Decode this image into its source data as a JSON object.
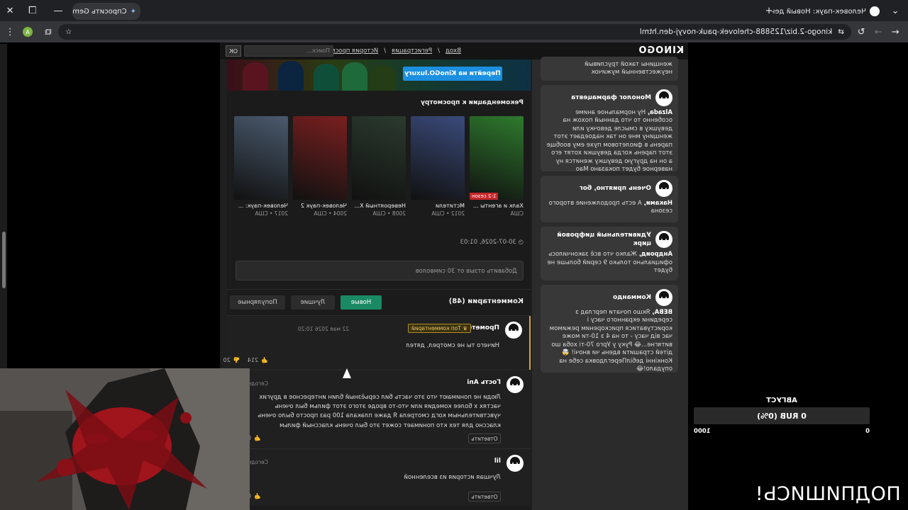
{
  "browser": {
    "tabs": [
      {
        "title": "Человек-паук: Новый день с"
      },
      {
        "title": "Спросить Gemini"
      }
    ],
    "new_tab": "+",
    "url": "kinogo-2.biz/125888-chelovek-pauk-novyj-den.html",
    "profile_initial": "A"
  },
  "site": {
    "logo": "KINOGO",
    "nav": [
      "Вход",
      "Регистрация",
      "История просмотров"
    ],
    "nav_separator": "/",
    "search_placeholder": "Поиск...",
    "search_button": "ОК",
    "banner_button": "Перейти на KinoGO.luxury"
  },
  "recommendations": {
    "title": "Рекомендации к просмотру",
    "items": [
      {
        "title": "Халк и агенты ...",
        "meta": "США",
        "badge": "1-2 сезон",
        "color": "#2e7a2d"
      },
      {
        "title": "Мстители",
        "meta": "2012 • США",
        "badge": "",
        "color": "#3a4a7a"
      },
      {
        "title": "Невероятный Х...",
        "meta": "2008 • США",
        "badge": "",
        "color": "#2b3a2e"
      },
      {
        "title": "Человек-паук 2",
        "meta": "2004 • США",
        "badge": "",
        "color": "#7a1f1f"
      },
      {
        "title": "Человек-паук: ...",
        "meta": "2017 • США",
        "badge": "",
        "color": "#4a5a6e"
      }
    ]
  },
  "publication_date": "30-07-2026, 01:03",
  "review": {
    "placeholder": "Добавить отзыв от 30 символов"
  },
  "comments": {
    "title": "Комментарии (48)",
    "filters": [
      "Новые",
      "Лучшие",
      "Популярные"
    ],
    "active_filter": "Новые",
    "items": [
      {
        "name": "Прометей",
        "badge": "Топ комментарий",
        "time": "22 мая 2026 10:20",
        "text": "Ничего ты не смотрел, дятел",
        "likes": "214",
        "dislikes": "20"
      },
      {
        "name": "Гость Ani",
        "time": "Сегодня",
        "text": "Люди не понимают что это часть бил серьёзный блин интересное в других частях х более комедия или что-то вроде этого этот фильм был очень чувствительным когд смотрела Я даже плакала 100 раз просто было очень классно для тех кто понимает сожет это был очень классный фильм",
        "reply": "Ответить",
        "likes": "0"
      },
      {
        "name": "lil",
        "time": "Сегодня",
        "text": "Лучшая история из вселенной",
        "reply": "Ответить",
        "likes": "0"
      }
    ]
  },
  "sidebar_cards": [
    {
      "title": "",
      "author": "",
      "text": "женщины такой трусливый неужественный мужичок"
    },
    {
      "title": "Монолог фармацевта",
      "author": "Alzada,",
      "text": "Ну нормальное аниме особенно то что данный похож на девушку в смысле девочку или женщину мне он так надоедает этот парень в фиолетовом пухе ему вообще этот парень когда девушки хотят его а он на другую девушку женится ну наверное будет показано Мао"
    },
    {
      "title": "Очень приятно, бог",
      "author": "Наками,",
      "text": "А есть продолжение второго сезона"
    },
    {
      "title": "Удивительный цифровой цирк",
      "author": "Андроид,",
      "text": "Жалко что всё закончилось официально только 9 серий больше не будет"
    },
    {
      "title": "Коммандо",
      "author": "BEBA,",
      "text": "Якшо почати перглад з середини екранного часу і користуватися прискореним режимом час від часу - то на 4 з 10-ти може витягне...😂 Руку у Урго 70-ті хоба шо дітей страшити вдень чи вночі! 🤯 Конкінні дебілПереглдовка себе на опудало!😂"
    }
  ],
  "donation": {
    "month": "АВГУСТ",
    "amount_text": "0 RUB (0%)",
    "scale_min": "0",
    "scale_max": "1000",
    "progress": 0
  },
  "overlay_text": "ПОДПИШИСЬ!"
}
